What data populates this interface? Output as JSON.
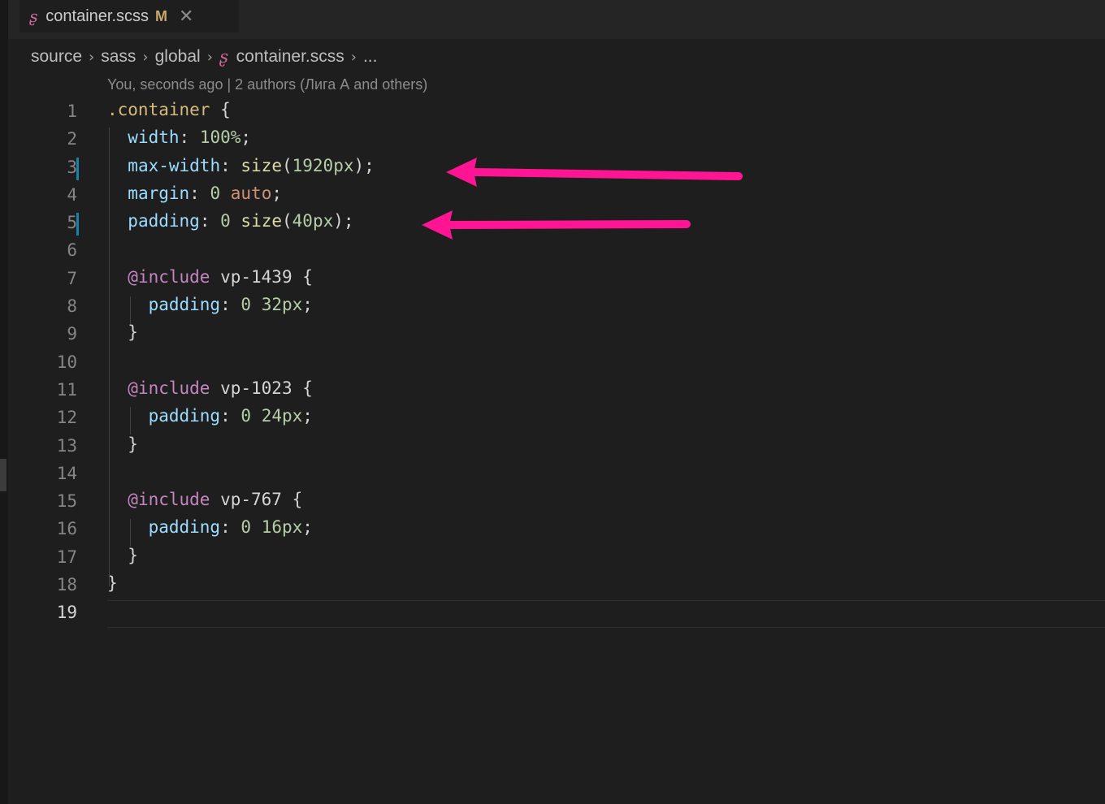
{
  "tab": {
    "filename": "container.scss",
    "status": "M",
    "close": "✕"
  },
  "breadcrumb": [
    "source",
    "sass",
    "global",
    "container.scss",
    "..."
  ],
  "blame": "You, seconds ago | 2 authors (Лига А and others)",
  "lines": [
    {
      "n": "1",
      "tokens": [
        [
          ".container",
          "t-sel"
        ],
        [
          " {",
          "t-p"
        ]
      ]
    },
    {
      "n": "2",
      "tokens": [
        [
          "  ",
          ""
        ],
        [
          "width",
          "t-prop"
        ],
        [
          ": ",
          "t-p"
        ],
        [
          "100%",
          "t-num"
        ],
        [
          ";",
          "t-p"
        ]
      ]
    },
    {
      "n": "3",
      "git": true,
      "tokens": [
        [
          "  ",
          ""
        ],
        [
          "max-width",
          "t-prop"
        ],
        [
          ": ",
          "t-p"
        ],
        [
          "size",
          "t-fn"
        ],
        [
          "(",
          "t-p"
        ],
        [
          "1920px",
          "t-num"
        ],
        [
          ");",
          "t-p"
        ]
      ]
    },
    {
      "n": "4",
      "tokens": [
        [
          "  ",
          ""
        ],
        [
          "margin",
          "t-prop"
        ],
        [
          ": ",
          "t-p"
        ],
        [
          "0",
          "t-num"
        ],
        [
          " ",
          "t-p"
        ],
        [
          "auto",
          "t-kw"
        ],
        [
          ";",
          "t-p"
        ]
      ]
    },
    {
      "n": "5",
      "git": true,
      "tokens": [
        [
          "  ",
          ""
        ],
        [
          "padding",
          "t-prop"
        ],
        [
          ": ",
          "t-p"
        ],
        [
          "0",
          "t-num"
        ],
        [
          " ",
          "t-p"
        ],
        [
          "size",
          "t-fn"
        ],
        [
          "(",
          "t-p"
        ],
        [
          "40px",
          "t-num"
        ],
        [
          ");",
          "t-p"
        ]
      ]
    },
    {
      "n": "6",
      "tokens": []
    },
    {
      "n": "7",
      "tokens": [
        [
          "  ",
          ""
        ],
        [
          "@include",
          "t-at"
        ],
        [
          " vp-1439 {",
          "t-p"
        ]
      ]
    },
    {
      "n": "8",
      "tokens": [
        [
          "    ",
          ""
        ],
        [
          "padding",
          "t-prop"
        ],
        [
          ": ",
          "t-p"
        ],
        [
          "0",
          "t-num"
        ],
        [
          " ",
          "t-p"
        ],
        [
          "32px",
          "t-num"
        ],
        [
          ";",
          "t-p"
        ]
      ]
    },
    {
      "n": "9",
      "tokens": [
        [
          "  ",
          ""
        ],
        [
          "}",
          "t-p"
        ]
      ]
    },
    {
      "n": "10",
      "tokens": []
    },
    {
      "n": "11",
      "tokens": [
        [
          "  ",
          ""
        ],
        [
          "@include",
          "t-at"
        ],
        [
          " vp-1023 {",
          "t-p"
        ]
      ]
    },
    {
      "n": "12",
      "tokens": [
        [
          "    ",
          ""
        ],
        [
          "padding",
          "t-prop"
        ],
        [
          ": ",
          "t-p"
        ],
        [
          "0",
          "t-num"
        ],
        [
          " ",
          "t-p"
        ],
        [
          "24px",
          "t-num"
        ],
        [
          ";",
          "t-p"
        ]
      ]
    },
    {
      "n": "13",
      "tokens": [
        [
          "  ",
          ""
        ],
        [
          "}",
          "t-p"
        ]
      ]
    },
    {
      "n": "14",
      "tokens": []
    },
    {
      "n": "15",
      "tokens": [
        [
          "  ",
          ""
        ],
        [
          "@include",
          "t-at"
        ],
        [
          " vp-767 {",
          "t-p"
        ]
      ]
    },
    {
      "n": "16",
      "tokens": [
        [
          "    ",
          ""
        ],
        [
          "padding",
          "t-prop"
        ],
        [
          ": ",
          "t-p"
        ],
        [
          "0",
          "t-num"
        ],
        [
          " ",
          "t-p"
        ],
        [
          "16px",
          "t-num"
        ],
        [
          ";",
          "t-p"
        ]
      ]
    },
    {
      "n": "17",
      "tokens": [
        [
          "  ",
          ""
        ],
        [
          "}",
          "t-p"
        ]
      ]
    },
    {
      "n": "18",
      "tokens": [
        [
          "}",
          "t-p"
        ]
      ]
    },
    {
      "n": "19",
      "active": true,
      "tokens": []
    }
  ],
  "colors": {
    "arrow": "#ff1493",
    "git_modified": "#1b81a8",
    "sass": "#cd6799"
  }
}
